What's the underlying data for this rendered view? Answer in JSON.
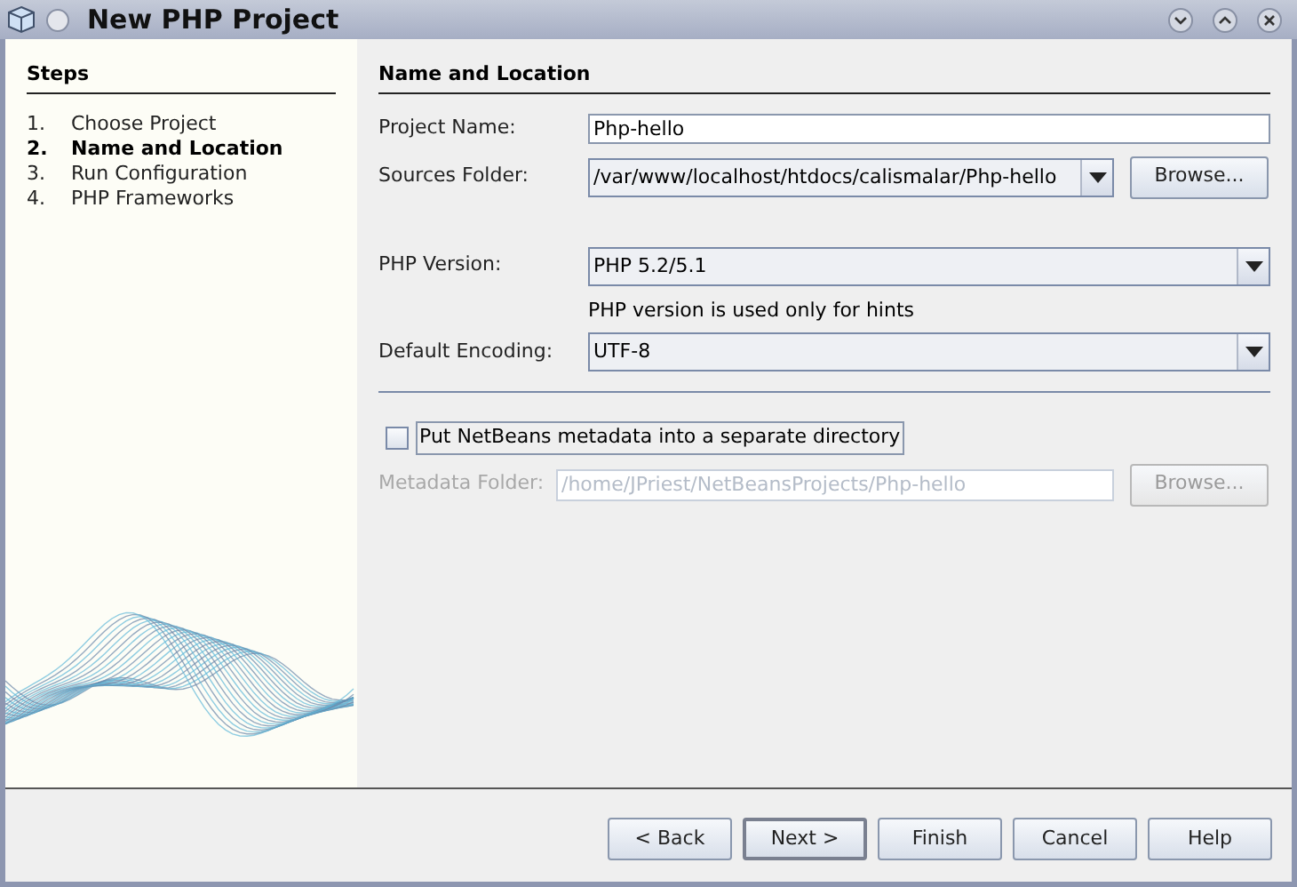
{
  "window": {
    "title": "New PHP Project"
  },
  "steps": {
    "title": "Steps",
    "items": [
      {
        "number": "1.",
        "label": "Choose Project",
        "selected": false
      },
      {
        "number": "2.",
        "label": "Name and Location",
        "selected": true
      },
      {
        "number": "3.",
        "label": "Run Configuration",
        "selected": false
      },
      {
        "number": "4.",
        "label": "PHP Frameworks",
        "selected": false
      }
    ]
  },
  "panel": {
    "title": "Name and Location",
    "project_name": {
      "label": "Project Name:",
      "value": "Php-hello"
    },
    "sources_folder": {
      "label": "Sources Folder:",
      "value": "/var/www/localhost/htdocs/calismalar/Php-hello",
      "button": "Browse..."
    },
    "php_version": {
      "label": "PHP Version:",
      "value": "PHP 5.2/5.1",
      "hint": "PHP version is used only for hints"
    },
    "default_encoding": {
      "label": "Default Encoding:",
      "value": "UTF-8"
    },
    "metadata_checkbox": {
      "label": "Put NetBeans metadata into a separate directory",
      "checked": false
    },
    "metadata_folder": {
      "label": "Metadata Folder:",
      "value": "/home/JPriest/NetBeansProjects/Php-hello",
      "button": "Browse...",
      "disabled": true
    }
  },
  "buttons": [
    {
      "label": "< Back",
      "default": false
    },
    {
      "label": "Next >",
      "default": true
    },
    {
      "label": "Finish",
      "default": false
    },
    {
      "label": "Cancel",
      "default": false
    },
    {
      "label": "Help",
      "default": false
    }
  ]
}
